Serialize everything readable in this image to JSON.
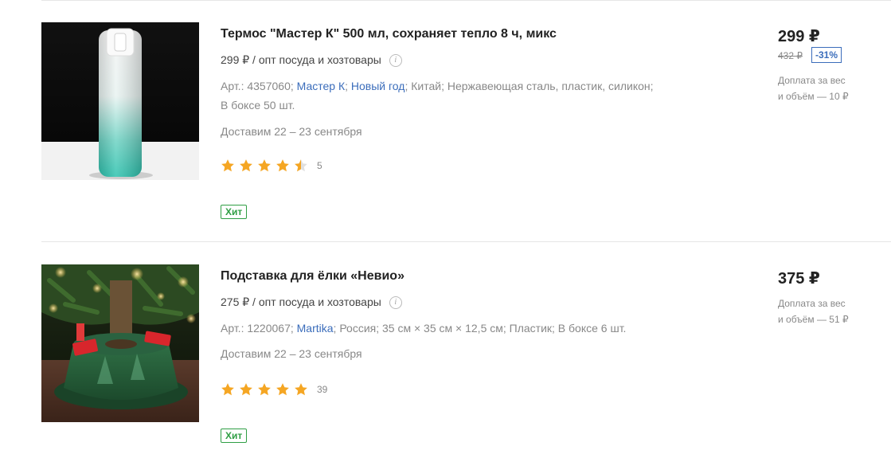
{
  "products": [
    {
      "title": "Термос \"Мастер К\" 500 мл, сохраняет тепло 8 ч, микс",
      "opt": "299 ₽ / опт посуда и хозтовары",
      "article": "Арт.: 4357060;",
      "brand": "Мастер К",
      "tag": "Новый год",
      "country": "Китай;",
      "material": "Нержавеющая сталь, пластик, силикон;",
      "box": "В боксе 50 шт.",
      "delivery": "Доставим 22 – 23 сентября",
      "rating": 4.5,
      "reviews": "5",
      "badge": "Хит",
      "price": "299 ₽",
      "old_price": "432 ₽",
      "discount": "-31%",
      "extra_line1": "Доплата за вес",
      "extra_line2": "и объём — 10 ₽"
    },
    {
      "title": "Подставка для ёлки «Невио»",
      "opt": "275 ₽ / опт посуда и хозтовары",
      "article": "Арт.: 1220067;",
      "brand": "Martika",
      "details": "Россия; 35 см × 35 см × 12,5 см; Пластик; В боксе 6 шт.",
      "delivery": "Доставим 22 – 23 сентября",
      "rating": 5,
      "reviews": "39",
      "badge": "Хит",
      "price": "375 ₽",
      "extra_line1": "Доплата за вес",
      "extra_line2": "и объём — 51 ₽"
    }
  ],
  "colors": {
    "star": "#f5a623",
    "link": "#3b6dbb",
    "hit": "#2f9e44"
  },
  "icons": {
    "info": "info-icon",
    "star": "star-icon"
  }
}
